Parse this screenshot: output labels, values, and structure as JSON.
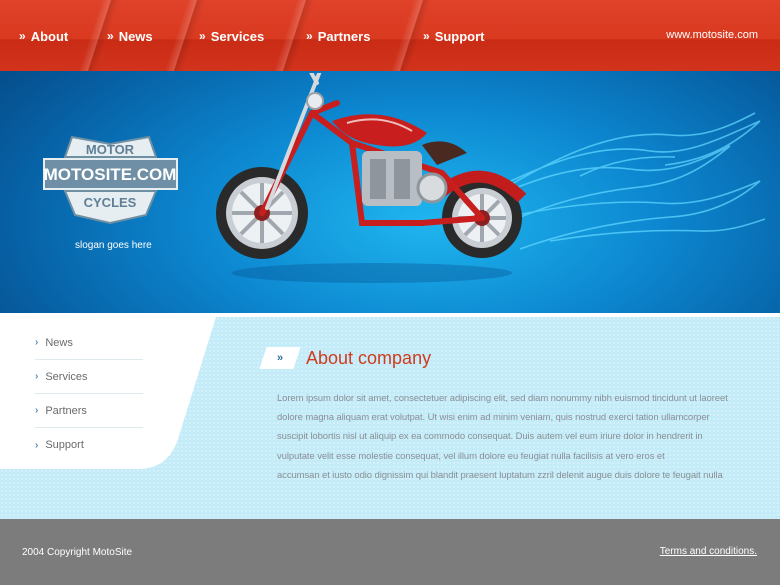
{
  "nav": {
    "items": [
      {
        "label": "About"
      },
      {
        "label": "News"
      },
      {
        "label": "Services"
      },
      {
        "label": "Partners"
      },
      {
        "label": "Support"
      }
    ],
    "url": "www.motosite.com"
  },
  "banner": {
    "logo": {
      "top": "MOTOR",
      "middle": "MOTOSITE.COM",
      "bottom": "CYCLES"
    },
    "slogan": "slogan goes here"
  },
  "sidebar": {
    "items": [
      {
        "label": "News"
      },
      {
        "label": "Services"
      },
      {
        "label": "Partners"
      },
      {
        "label": "Support"
      }
    ]
  },
  "main": {
    "title": "About company",
    "lines": [
      "Lorem ipsum dolor sit amet, consectetuer adipiscing elit, sed diam nonummy nibh euismod tincidunt ut laoreet",
      "dolore magna aliquam erat volutpat. Ut wisi enim ad minim veniam, quis nostrud exerci tation ullamcorper",
      "suscipit lobortis nisl ut aliquip ex ea commodo consequat. Duis autem vel eum iriure dolor in hendrerit in",
      "vulputate velit esse molestie consequat, vel illum dolore eu feugiat nulla facilisis at vero eros et",
      "accumsan et iusto odio dignissim qui blandit praesent luptatum zzril delenit augue duis dolore te feugait nulla"
    ]
  },
  "footer": {
    "copyright": "2004 Copyright MotoSite",
    "terms": "Terms and conditions."
  },
  "colors": {
    "nav_red": "#d8391f",
    "banner_blue": "#0c86cf",
    "content_blue": "#c3ecf8",
    "title_red": "#d03a1d",
    "footer_gray": "#7c7c7c"
  }
}
